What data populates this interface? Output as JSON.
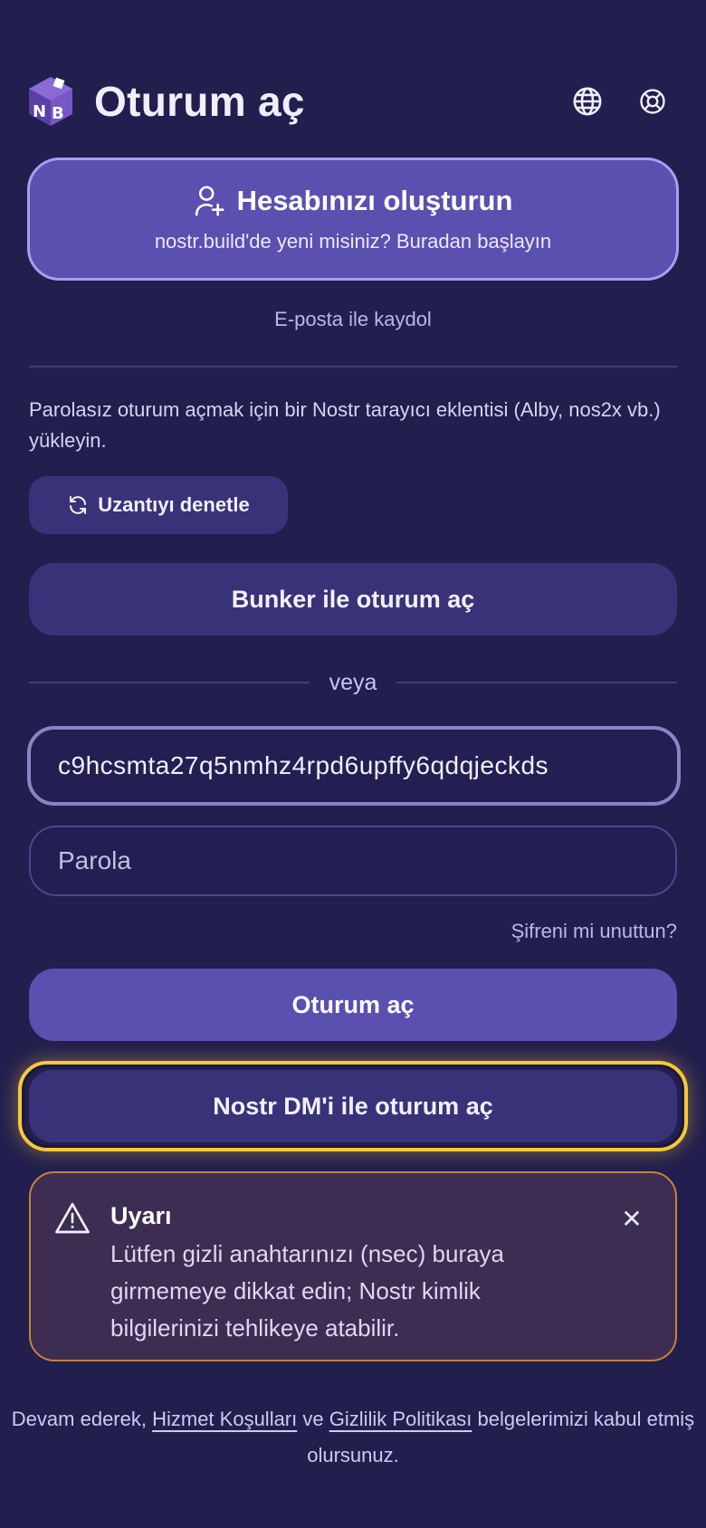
{
  "header": {
    "title": "Oturum aç",
    "logo_letters": "NB",
    "icons": [
      "globe-icon",
      "lifebuoy-icon"
    ]
  },
  "create_account": {
    "title": "Hesabınızı oluşturun",
    "subtitle": "nostr.build'de yeni misiniz? Buradan başlayın",
    "icon": "user-plus-icon"
  },
  "email_signup": "E-posta ile kaydol",
  "extension": {
    "info": "Parolasız oturum açmak için bir Nostr tarayıcı eklentisi (Alby, nos2x vb.) yükleyin.",
    "check_label": "Uzantıyı denetle",
    "check_icon": "refresh-icon"
  },
  "bunker_label": "Bunker ile oturum aç",
  "or_label": "veya",
  "form": {
    "key_value": "c9hcsmta27q5nmhz4rpd6upffy6qdqjeckds",
    "password_placeholder": "Parola",
    "forgot_label": "Şifreni mi unuttun?",
    "login_label": "Oturum aç"
  },
  "dm_login_label": "Nostr DM'i ile oturum aç",
  "warning": {
    "title": "Uyarı",
    "text": "Lütfen gizli anahtarınızı (nsec) buraya girmemeye dikkat edin; Nostr kimlik bilgilerinizi tehlikeye atabilir.",
    "icon": "warning-triangle-icon",
    "close_glyph": "✕"
  },
  "footer": {
    "prefix": "Devam ederek, ",
    "terms_label": "Hizmet Koşulları",
    "conjunction": " ve ",
    "privacy_label": "Gizlilik Politikası",
    "suffix": " belgelerimizi kabul etmiş olursunuz."
  },
  "colors": {
    "background": "#221e4e",
    "primary": "#5b4fb0",
    "secondary": "#3a3278",
    "highlight": "#f6c83c",
    "warning_border": "#c9823a"
  }
}
